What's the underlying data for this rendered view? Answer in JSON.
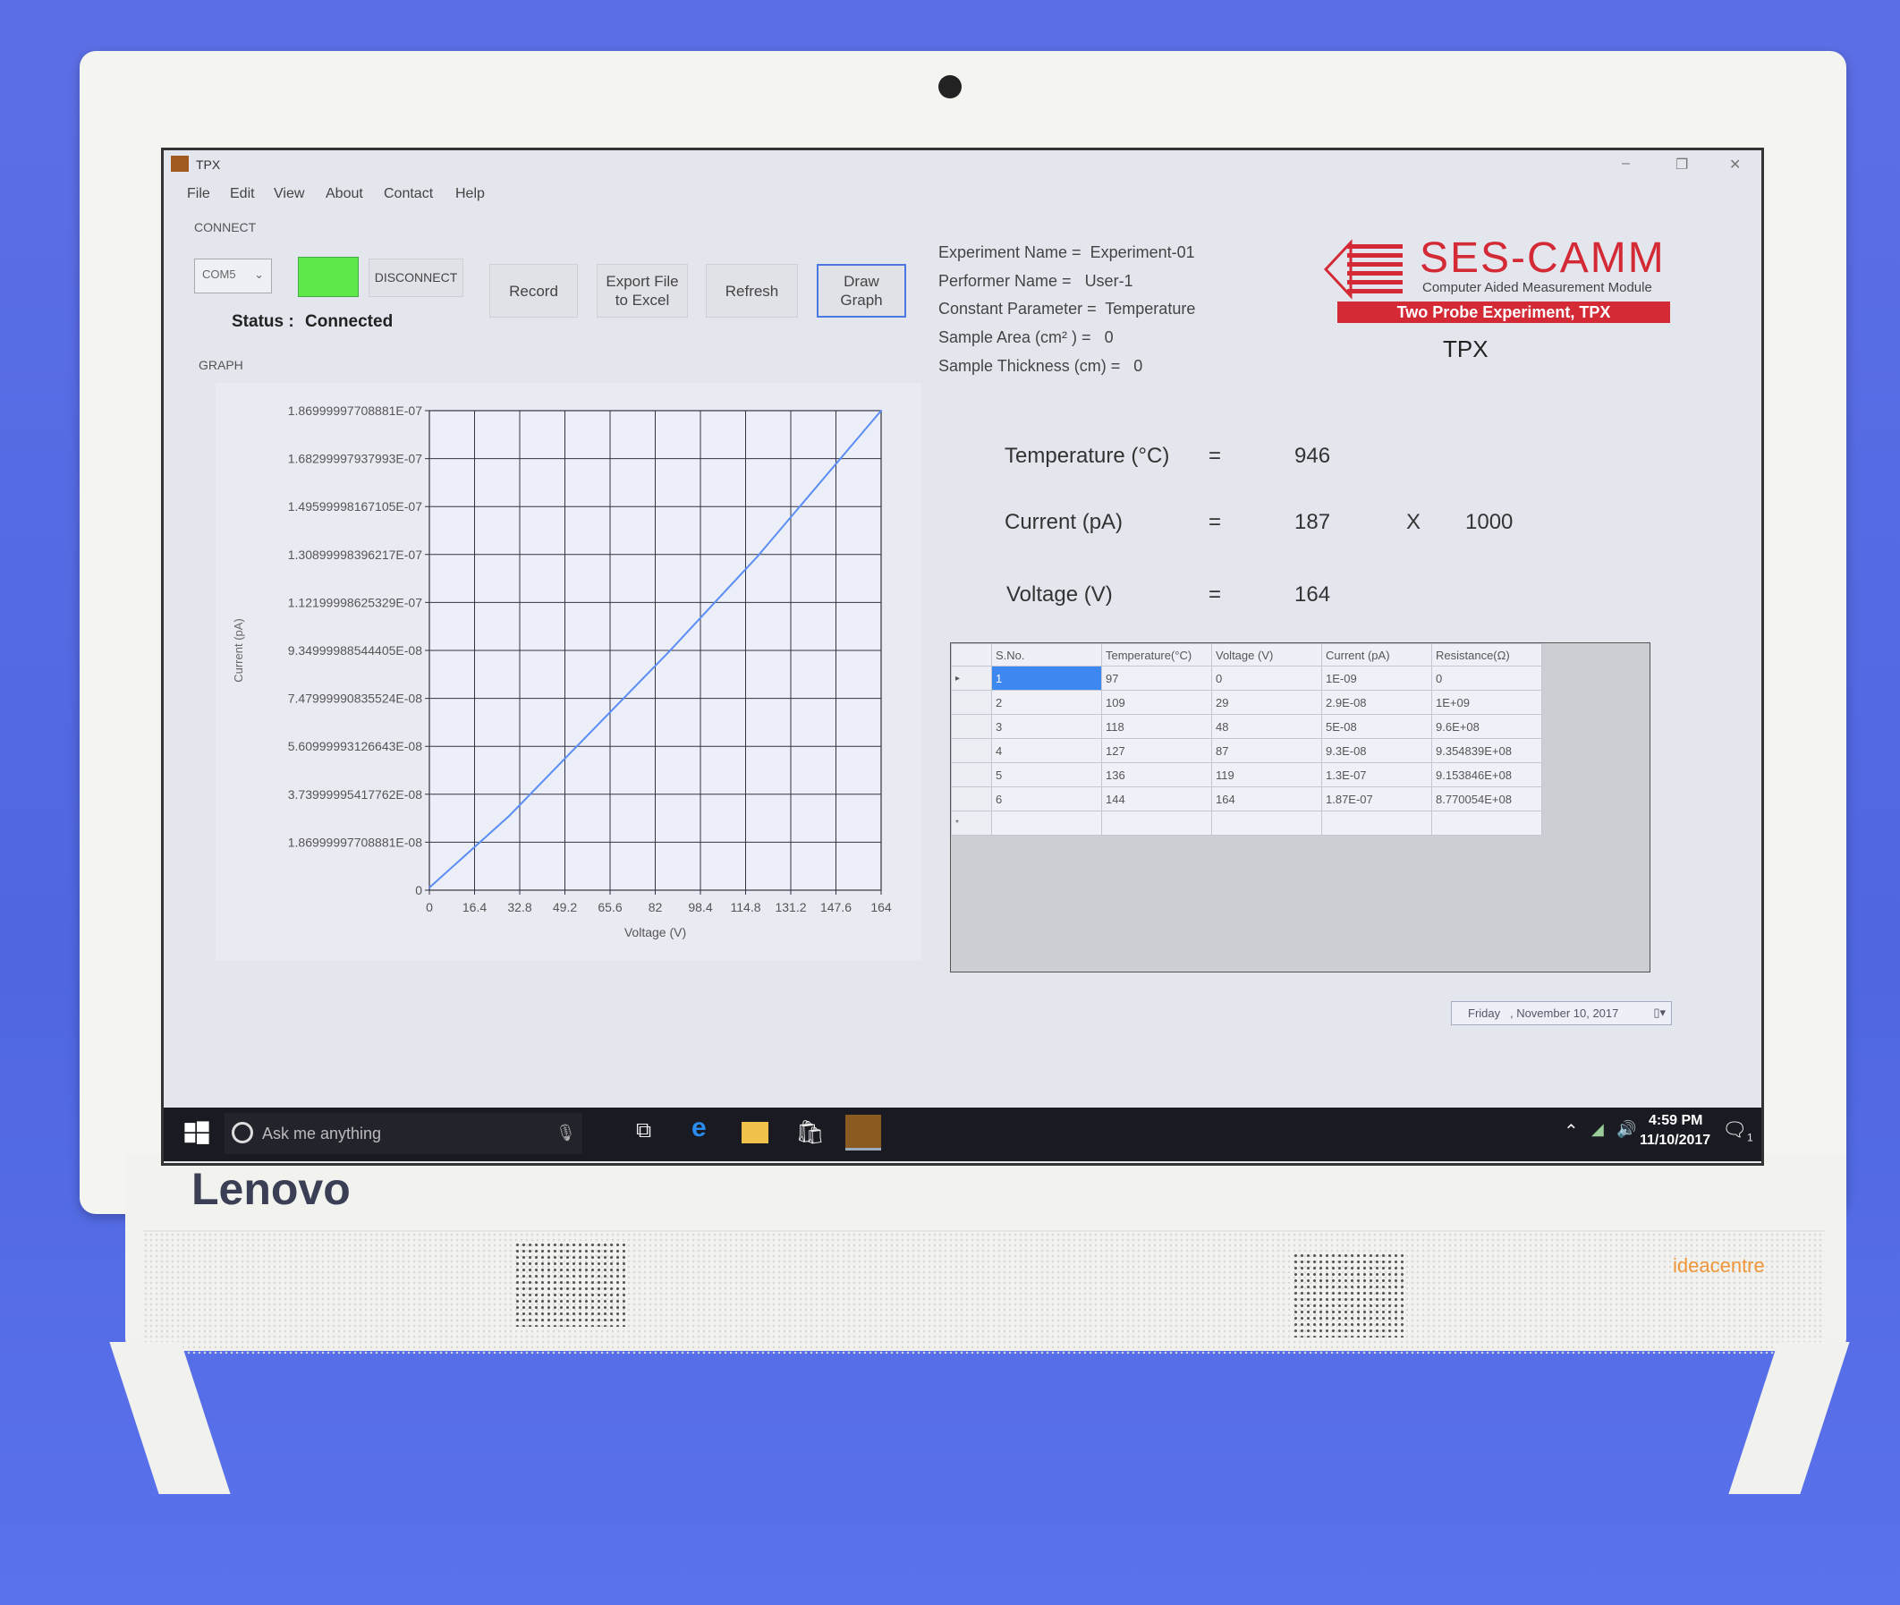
{
  "window": {
    "title": "TPX",
    "controls": [
      "–",
      "❐",
      "✕"
    ]
  },
  "menu": [
    "File",
    "Edit",
    "View",
    "About",
    "Contact",
    "Help"
  ],
  "connect": {
    "section_label": "CONNECT",
    "port": "COM5",
    "indicator_color": "#5ee84a",
    "disconnect_label": "DISCONNECT",
    "status_label": "Status :",
    "status_value": "Connected"
  },
  "toolbar": {
    "record": "Record",
    "export": "Export File to Excel",
    "refresh": "Refresh",
    "draw": "Draw Graph"
  },
  "experiment": {
    "lines": [
      {
        "label": "Experiment Name  =",
        "value": "Experiment-01"
      },
      {
        "label": "Performer Name =",
        "value": "User-1"
      },
      {
        "label": "Constant Parameter =",
        "value": "Temperature"
      },
      {
        "label": "Sample Area (cm² ) =",
        "value": "0"
      },
      {
        "label": "Sample Thickness  (cm) =",
        "value": "0"
      }
    ]
  },
  "logo": {
    "name": "SES-CAMM",
    "tagline": "Computer Aided Measurement Module",
    "banner": "Two Probe Experiment, TPX",
    "color": "#d42a35"
  },
  "app_label": "TPX",
  "graph_label": "GRAPH",
  "readings": {
    "temperature": {
      "label": "Temperature (°C)",
      "eq": "=",
      "value": "946"
    },
    "current": {
      "label": "Current (pA)",
      "eq": "=",
      "value": "187",
      "mult_sign": "X",
      "multiplier": "1000"
    },
    "voltage": {
      "label": "Voltage (V)",
      "eq": "=",
      "value": "164"
    }
  },
  "table": {
    "columns": [
      "S.No.",
      "Temperature(°C)",
      "Voltage (V)",
      "Current (pA)",
      "Resistance(Ω)"
    ],
    "rows": [
      [
        "1",
        "97",
        "0",
        "1E-09",
        "0"
      ],
      [
        "2",
        "109",
        "29",
        "2.9E-08",
        "1E+09"
      ],
      [
        "3",
        "118",
        "48",
        "5E-08",
        "9.6E+08"
      ],
      [
        "4",
        "127",
        "87",
        "9.3E-08",
        "9.354839E+08"
      ],
      [
        "5",
        "136",
        "119",
        "1.3E-07",
        "9.153846E+08"
      ],
      [
        "6",
        "144",
        "164",
        "1.87E-07",
        "8.770054E+08"
      ]
    ]
  },
  "date_picker": {
    "day": "Friday",
    "date": ", November 10, 2017"
  },
  "taskbar": {
    "search_placeholder": "Ask me anything",
    "time": "4:59 PM",
    "date": "11/10/2017",
    "notification_count": "1"
  },
  "device": {
    "brand": "Lenovo",
    "model": "ideacentre"
  },
  "chart_data": {
    "type": "line",
    "xlabel": "Voltage (V)",
    "ylabel": "Current (pA)",
    "xlim": [
      0,
      164
    ],
    "ylim": [
      0,
      1.86999997708881e-07
    ],
    "x_ticks": [
      "0",
      "16.4",
      "32.8",
      "49.2",
      "65.6",
      "82",
      "98.4",
      "114.8",
      "131.2",
      "147.6",
      "164"
    ],
    "y_ticks": [
      "0",
      "1.86999997708881E-08",
      "3.73999995417762E-08",
      "5.60999993126643E-08",
      "7.47999990835524E-08",
      "9.34999988544405E-08",
      "1.12199998625329E-07",
      "1.30899998396217E-07",
      "1.49599998167105E-07",
      "1.68299997937993E-07",
      "1.86999997708881E-07"
    ],
    "grid": true,
    "line_color": "#5b8ef5",
    "series": [
      {
        "x": [
          0,
          29,
          48,
          87,
          119,
          164
        ],
        "y": [
          1e-09,
          2.9e-08,
          5e-08,
          9.3e-08,
          1.3e-07,
          1.87e-07
        ]
      }
    ]
  }
}
